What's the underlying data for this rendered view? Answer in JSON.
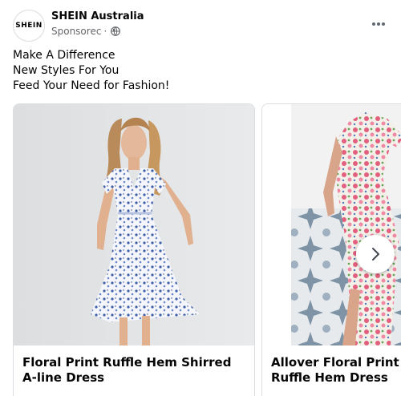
{
  "post": {
    "avatar_text": "SHEIN",
    "page_name": "SHEIN Australia",
    "sponsored_label": "Sponsorec",
    "separator": "·",
    "caption_lines": [
      "Make A Difference",
      "New Styles For You",
      "Feed Your Need for Fashion!"
    ]
  },
  "carousel": {
    "cards": [
      {
        "title_line1": "Floral Print Ruffle Hem Shirred",
        "title_line2": "A-line Dress"
      },
      {
        "title_line1": "Allover Floral Print",
        "title_line2": "Ruffle Hem Dress"
      }
    ]
  },
  "icons": {
    "privacy": "globe-icon",
    "menu": "more-options-icon",
    "next": "chevron-right-icon"
  },
  "colors": {
    "text_primary": "#050505",
    "text_secondary": "#65676b",
    "card_border": "#dadde1"
  }
}
